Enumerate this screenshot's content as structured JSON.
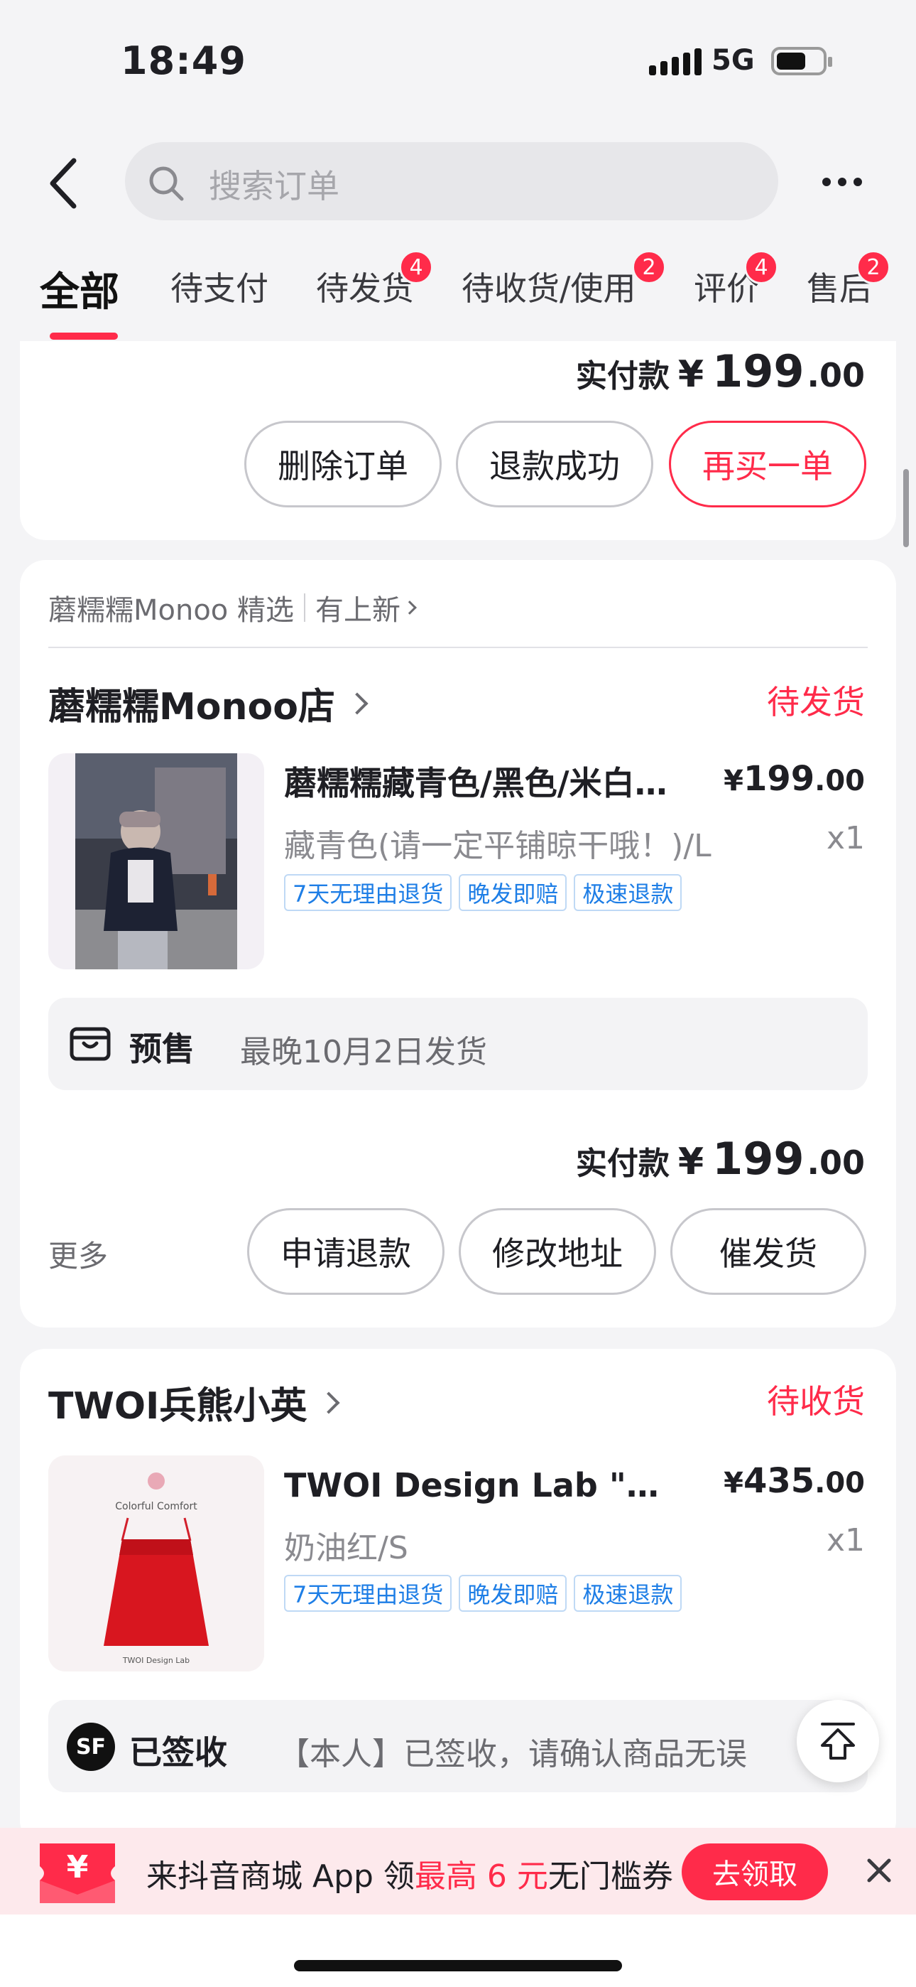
{
  "status_bar": {
    "time": "18:49",
    "network": "5G"
  },
  "header": {
    "search_placeholder": "搜索订单"
  },
  "tabs": [
    {
      "label": "全部",
      "active": true
    },
    {
      "label": "待支付"
    },
    {
      "label": "待发货",
      "badge": "4"
    },
    {
      "label": "待收货/使用",
      "badge": "2"
    },
    {
      "label": "评价",
      "badge": "4"
    },
    {
      "label": "售后",
      "badge": "2"
    }
  ],
  "order1": {
    "paid_label": "实付款",
    "currency": "¥",
    "amount_int": "199",
    "amount_dec": ".00",
    "buttons": [
      "删除订单",
      "退款成功",
      "再买一单"
    ]
  },
  "order2": {
    "recommend": "蘑糯糯Monoo 精选",
    "recommend_link": "有上新",
    "shop": "蘑糯糯Monoo店",
    "status": "待发货",
    "title": "蘑糯糯藏青色/黑色/米白色卫衣",
    "price_cur": "¥",
    "price_int": "199",
    "price_dec": ".00",
    "spec": "藏青色(请一定平铺晾干哦！)/L",
    "qty": "x1",
    "tags": [
      "7天无理由退货",
      "晚发即赔",
      "极速退款"
    ],
    "presale_label": "预售",
    "presale_text": "最晚10月2日发货",
    "paid_label": "实付款",
    "currency": "¥",
    "amount_int": "199",
    "amount_dec": ".00",
    "more": "更多",
    "buttons": [
      "申请退款",
      "修改地址",
      "催发货"
    ]
  },
  "order3": {
    "shop": "TWOI兵熊小英",
    "status": "待收货",
    "title": "TWOI Design Lab \"五彩缤纷\"",
    "price_cur": "¥",
    "price_int": "435",
    "price_dec": ".00",
    "spec": "奶油红/S",
    "qty": "x1",
    "tags": [
      "7天无理由退货",
      "晚发即赔",
      "极速退款"
    ],
    "thumb_caption_top": "Colorful Comfort",
    "thumb_caption_bottom": "TWOI Design Lab",
    "logistics_icon": "SF",
    "signed_label": "已签收",
    "signed_text": "【本人】已签收，请确认商品无误"
  },
  "banner": {
    "coupon_symbol": "¥",
    "text_pre": "来抖音商城 App 领",
    "text_highlight": "最高 6 元",
    "text_post": "无门槛券",
    "cta": "去领取"
  }
}
